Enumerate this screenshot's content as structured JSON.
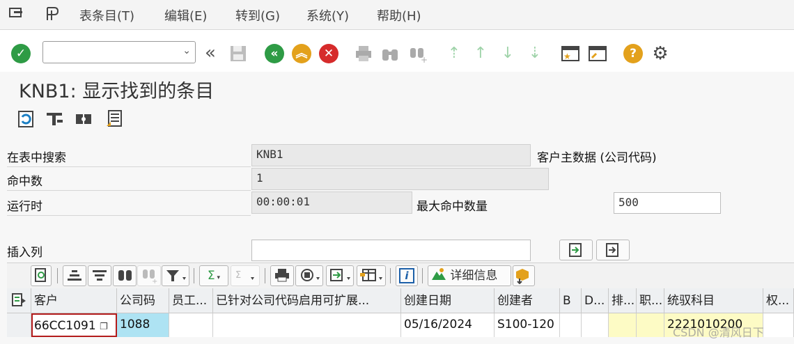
{
  "menu": {
    "items": [
      {
        "label": "表条目(T)"
      },
      {
        "label": "编辑(E)"
      },
      {
        "label": "转到(G)"
      },
      {
        "label": "系统(Y)"
      },
      {
        "label": "帮助(H)"
      }
    ]
  },
  "toolbar": {
    "command_field_value": ""
  },
  "page": {
    "title": "KNB1: 显示找到的条目"
  },
  "search": {
    "table_label": "在表中搜索",
    "table_value": "KNB1",
    "table_desc": "客户主数据 (公司代码)",
    "hits_label": "命中数",
    "hits_value": "1",
    "runtime_label": "运行时",
    "runtime_value": "00:00:01",
    "max_hits_label": "最大命中数量",
    "max_hits_value": "500",
    "insert_col_label": "插入列",
    "insert_col_value": ""
  },
  "alv": {
    "sum_symbol": "Σ",
    "info_symbol": "i",
    "details_label": "详细信息"
  },
  "grid": {
    "columns": [
      "客户",
      "公司码",
      "员工...",
      "已针对公司代码启用可扩展...",
      "创建日期",
      "创建者",
      "B",
      "D...",
      "排...",
      "职...",
      "统驭科目",
      "权..."
    ],
    "rows": [
      [
        "66CC1091",
        "1088",
        "",
        "",
        "05/16/2024",
        "S100-120",
        "",
        "",
        "",
        "",
        "2221010200",
        ""
      ]
    ]
  },
  "watermark": "CSDN @清风日下"
}
